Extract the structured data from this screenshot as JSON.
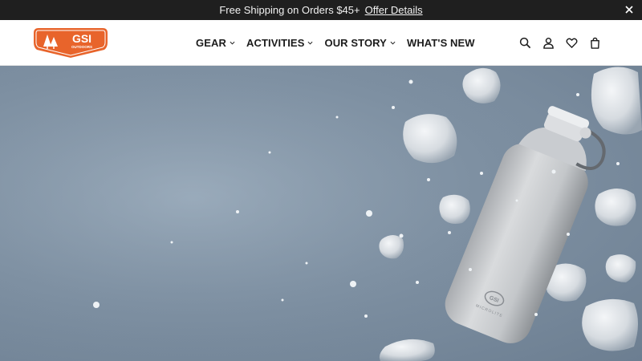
{
  "announcement": {
    "message": "Free Shipping on Orders $45+",
    "link_label": "Offer Details"
  },
  "brand": {
    "logo_text": "GSI",
    "logo_subtext": "OUTDOORS",
    "color": "#e8642b"
  },
  "nav": {
    "items": [
      {
        "label": "GEAR",
        "has_dropdown": true
      },
      {
        "label": "ACTIVITIES",
        "has_dropdown": true
      },
      {
        "label": "OUR STORY",
        "has_dropdown": true
      },
      {
        "label": "WHAT'S NEW",
        "has_dropdown": false
      }
    ]
  },
  "tools": [
    "search-icon",
    "account-icon",
    "wishlist-icon",
    "cart-icon"
  ],
  "hero": {
    "bottle_brand": "GSI",
    "bottle_text": "MICROLITE"
  }
}
